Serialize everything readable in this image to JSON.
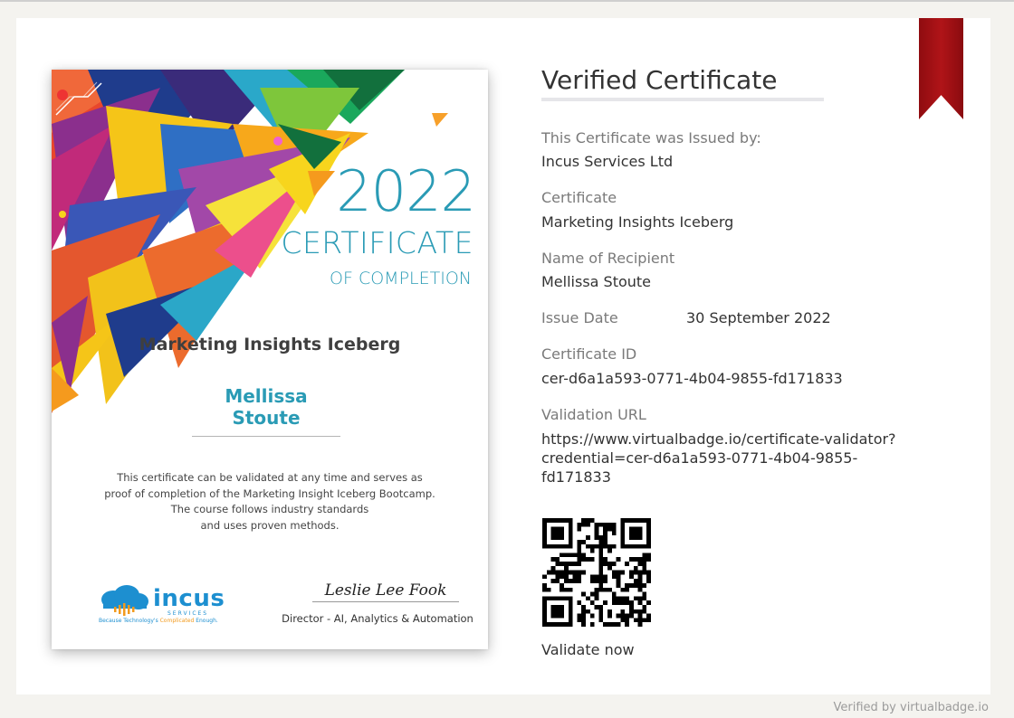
{
  "certificate_preview": {
    "year": "2022",
    "title": "CERTIFICATE",
    "subtitle": "OF COMPLETION",
    "course": "Marketing Insights Iceberg",
    "recipient": "Mellissa Stoute",
    "description_lines": [
      "This certificate can be validated at any time and serves as",
      "proof of completion of the Marketing Insight Iceberg Bootcamp.",
      "The course follows industry standards",
      "and uses proven methods."
    ],
    "logo_name": "incus",
    "logo_sub": "SERVICES",
    "logo_tagline_a": "Because Technology's ",
    "logo_tagline_b": "Complicated",
    "logo_tagline_c": " Enough.",
    "signature": "Leslie Lee Fook",
    "signer_role": "Director - AI, Analytics & Automation"
  },
  "details": {
    "heading": "Verified Certificate",
    "issued_by_label": "This Certificate was Issued by:",
    "issued_by": "Incus Services Ltd",
    "certificate_label": "Certificate",
    "certificate": "Marketing Insights Iceberg",
    "recipient_label": "Name of Recipient",
    "recipient": "Mellissa Stoute",
    "issue_date_label": "Issue Date",
    "issue_date": "30 September 2022",
    "certificate_id_label": "Certificate ID",
    "certificate_id": "cer-d6a1a593-0771-4b04-9855-fd171833",
    "validation_url_label": "Validation URL",
    "validation_url_line1": "https://www.virtualbadge.io/certificate-validator?",
    "validation_url_line2": "credential=cer-d6a1a593-0771-4b04-9855-fd171833",
    "validate_link": "Validate now"
  },
  "footer": "Verified by virtualbadge.io",
  "colors": {
    "accent": "#2a9bb5",
    "ribbon": "#a81216",
    "logo": "#1d8fd0"
  },
  "icons": [
    "ribbon-bookmark-icon",
    "qr-code-icon",
    "cloud-logo-icon"
  ]
}
